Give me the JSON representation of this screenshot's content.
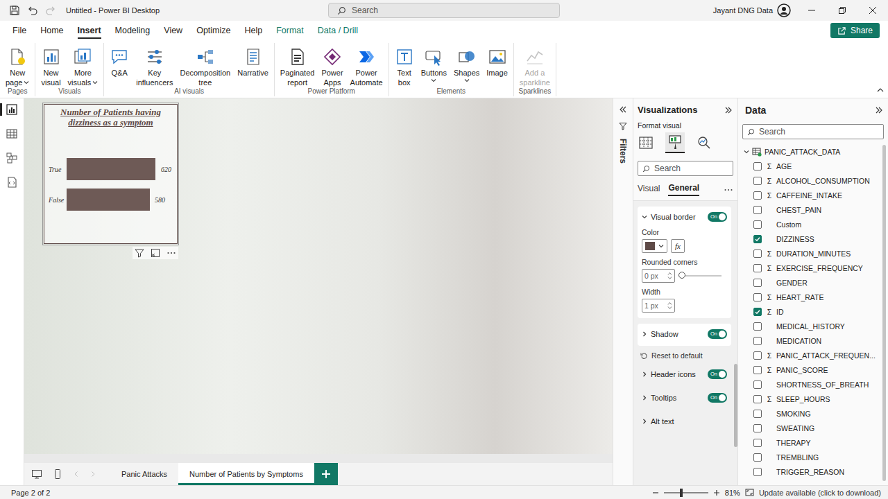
{
  "window": {
    "title": "Untitled - Power BI Desktop",
    "search_placeholder": "Search",
    "user": "Jayant DNG Data",
    "redo_disabled": true
  },
  "ribbon_tabs": [
    {
      "label": "File",
      "selected": false,
      "contextual": false
    },
    {
      "label": "Home",
      "selected": false,
      "contextual": false
    },
    {
      "label": "Insert",
      "selected": true,
      "contextual": false
    },
    {
      "label": "Modeling",
      "selected": false,
      "contextual": false
    },
    {
      "label": "View",
      "selected": false,
      "contextual": false
    },
    {
      "label": "Optimize",
      "selected": false,
      "contextual": false
    },
    {
      "label": "Help",
      "selected": false,
      "contextual": false
    },
    {
      "label": "Format",
      "selected": false,
      "contextual": true
    },
    {
      "label": "Data / Drill",
      "selected": false,
      "contextual": true
    }
  ],
  "share_button": {
    "label": "Share"
  },
  "ribbon_groups": [
    {
      "label": "Pages",
      "buttons": [
        {
          "kind": "page",
          "lines": [
            "New",
            "page"
          ],
          "dropdown": true,
          "disabled": false
        }
      ]
    },
    {
      "label": "Visuals",
      "buttons": [
        {
          "kind": "visual",
          "lines": [
            "New",
            "visual"
          ],
          "dropdown": false,
          "disabled": false
        },
        {
          "kind": "more",
          "lines": [
            "More",
            "visuals"
          ],
          "dropdown": true,
          "disabled": false
        }
      ]
    },
    {
      "label": "AI visuals",
      "buttons": [
        {
          "kind": "qa",
          "lines": [
            "Q&A"
          ],
          "dropdown": false,
          "disabled": false
        },
        {
          "kind": "influencers",
          "lines": [
            "Key",
            "influencers"
          ],
          "dropdown": false,
          "disabled": false
        },
        {
          "kind": "decomposition",
          "lines": [
            "Decomposition",
            "tree"
          ],
          "dropdown": false,
          "disabled": false
        },
        {
          "kind": "narrative",
          "lines": [
            "Narrative"
          ],
          "dropdown": false,
          "disabled": false
        }
      ]
    },
    {
      "label": "Power Platform",
      "buttons": [
        {
          "kind": "paginated",
          "lines": [
            "Paginated",
            "report"
          ],
          "dropdown": false,
          "disabled": false
        },
        {
          "kind": "apps",
          "lines": [
            "Power",
            "Apps"
          ],
          "dropdown": false,
          "disabled": false
        },
        {
          "kind": "automate",
          "lines": [
            "Power",
            "Automate"
          ],
          "dropdown": false,
          "disabled": false
        }
      ]
    },
    {
      "label": "Elements",
      "buttons": [
        {
          "kind": "textbox",
          "lines": [
            "Text",
            "box"
          ],
          "dropdown": false,
          "disabled": false
        },
        {
          "kind": "buttons",
          "lines": [
            "Buttons"
          ],
          "dropdown": true,
          "disabled": false
        },
        {
          "kind": "shapes",
          "lines": [
            "Shapes"
          ],
          "dropdown": true,
          "disabled": false
        },
        {
          "kind": "image",
          "lines": [
            "Image"
          ],
          "dropdown": false,
          "disabled": false
        }
      ]
    },
    {
      "label": "Sparklines",
      "buttons": [
        {
          "kind": "sparkline",
          "lines": [
            "Add a",
            "sparkline"
          ],
          "dropdown": false,
          "disabled": true
        }
      ]
    }
  ],
  "report_views": [
    {
      "kind": "report",
      "selected": true
    },
    {
      "kind": "table",
      "selected": false
    },
    {
      "kind": "model",
      "selected": false
    },
    {
      "kind": "dax",
      "selected": false
    }
  ],
  "visual": {
    "title": "Number of Patients having dizziness as a symptom",
    "categories": [
      "True",
      "False"
    ],
    "values": [
      620,
      580
    ],
    "value_labels": [
      "620",
      "580"
    ],
    "selected": true
  },
  "filters_pane": {
    "label": "Filters",
    "expanded": false
  },
  "visualizations": {
    "title": "Visualizations",
    "subtitle": "Format visual",
    "search_placeholder": "Search",
    "format_tabs": [
      {
        "kind": "build",
        "selected": false
      },
      {
        "kind": "format",
        "selected": true
      },
      {
        "kind": "analytics",
        "selected": false
      }
    ],
    "tabs": [
      {
        "label": "Visual",
        "selected": false
      },
      {
        "label": "General",
        "selected": true
      }
    ],
    "sections": [
      {
        "label": "Visual border",
        "expanded": true,
        "toggle": {
          "on": true,
          "label": "On"
        },
        "fields": [
          {
            "kind": "color",
            "label": "Color",
            "color": "#5e4a47",
            "fx": "fx"
          },
          {
            "kind": "slider",
            "label": "Rounded corners",
            "value": "0 px",
            "level": 0
          },
          {
            "kind": "spin",
            "label": "Width",
            "value": "1 px"
          }
        ]
      },
      {
        "label": "Shadow",
        "expanded": false,
        "toggle": {
          "on": true,
          "label": "On"
        },
        "fields": []
      }
    ],
    "reset_label": "Reset to default",
    "more_sections": [
      {
        "label": "Header icons",
        "expanded": false,
        "toggle": {
          "on": true,
          "label": "On"
        }
      },
      {
        "label": "Tooltips",
        "expanded": false,
        "toggle": {
          "on": true,
          "label": "On"
        }
      },
      {
        "label": "Alt text",
        "expanded": false,
        "toggle": null
      }
    ]
  },
  "data_pane": {
    "title": "Data",
    "search_placeholder": "Search",
    "sigma_glyph": "Σ",
    "table": {
      "name": "PANIC_ATTACK_DATA",
      "expanded": true
    },
    "fields": [
      {
        "name": "AGE",
        "sigma": true,
        "checked": false
      },
      {
        "name": "ALCOHOL_CONSUMPTION",
        "sigma": true,
        "checked": false
      },
      {
        "name": "CAFFEINE_INTAKE",
        "sigma": true,
        "checked": false
      },
      {
        "name": "CHEST_PAIN",
        "sigma": false,
        "checked": false
      },
      {
        "name": "Custom",
        "sigma": false,
        "checked": false
      },
      {
        "name": "DIZZINESS",
        "sigma": false,
        "checked": true
      },
      {
        "name": "DURATION_MINUTES",
        "sigma": true,
        "checked": false
      },
      {
        "name": "EXERCISE_FREQUENCY",
        "sigma": true,
        "checked": false
      },
      {
        "name": "GENDER",
        "sigma": false,
        "checked": false
      },
      {
        "name": "HEART_RATE",
        "sigma": true,
        "checked": false
      },
      {
        "name": "ID",
        "sigma": true,
        "checked": true
      },
      {
        "name": "MEDICAL_HISTORY",
        "sigma": false,
        "checked": false
      },
      {
        "name": "MEDICATION",
        "sigma": false,
        "checked": false
      },
      {
        "name": "PANIC_ATTACK_FREQUEN...",
        "sigma": true,
        "checked": false
      },
      {
        "name": "PANIC_SCORE",
        "sigma": true,
        "checked": false
      },
      {
        "name": "SHORTNESS_OF_BREATH",
        "sigma": false,
        "checked": false
      },
      {
        "name": "SLEEP_HOURS",
        "sigma": true,
        "checked": false
      },
      {
        "name": "SMOKING",
        "sigma": false,
        "checked": false
      },
      {
        "name": "SWEATING",
        "sigma": false,
        "checked": false
      },
      {
        "name": "THERAPY",
        "sigma": false,
        "checked": false
      },
      {
        "name": "TREMBLING",
        "sigma": false,
        "checked": false
      },
      {
        "name": "TRIGGER_REASON",
        "sigma": false,
        "checked": false
      }
    ]
  },
  "page_tabs": [
    {
      "label": "Panic Attacks",
      "selected": false
    },
    {
      "label": "Number of Patients by Symptoms",
      "selected": true
    }
  ],
  "status_bar": {
    "page": "Page 2 of 2",
    "zoom": "81%",
    "zoom_level": 0.4,
    "update": "Update available (click to download)"
  }
}
